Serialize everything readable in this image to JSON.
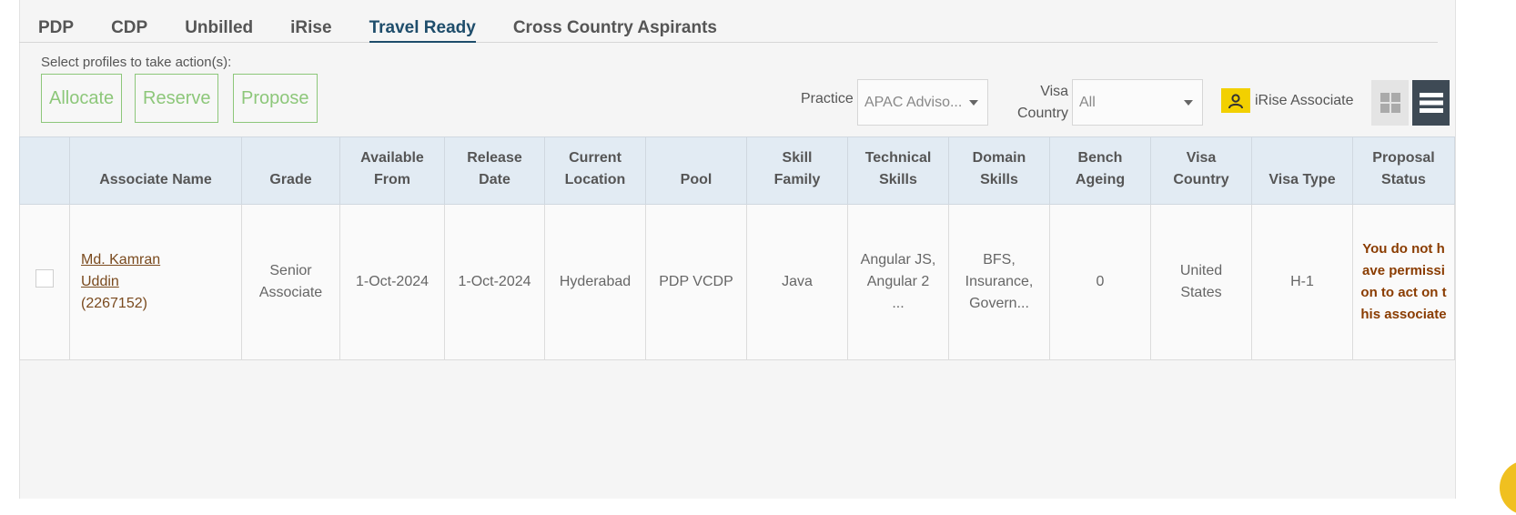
{
  "tabs": [
    {
      "label": "PDP",
      "active": false
    },
    {
      "label": "CDP",
      "active": false
    },
    {
      "label": "Unbilled",
      "active": false
    },
    {
      "label": "iRise",
      "active": false
    },
    {
      "label": "Travel Ready",
      "active": true
    },
    {
      "label": "Cross Country Aspirants",
      "active": false
    }
  ],
  "actions": {
    "prompt": "Select profiles to take action(s):",
    "allocate": "Allocate",
    "reserve": "Reserve",
    "propose": "Propose"
  },
  "filters": {
    "practice_label": "Practice",
    "practice_value": "APAC Adviso...",
    "visa_label_line1": "Visa",
    "visa_label_line2": "Country",
    "visa_value": "All"
  },
  "irise_toggle": {
    "label": "iRise Associate",
    "icon": "person-icon"
  },
  "view_toggle": {
    "grid_icon": "grid-view-icon",
    "list_icon": "list-view-icon"
  },
  "table": {
    "headers": [
      {
        "l1": "",
        "l2": ""
      },
      {
        "l1": "",
        "l2": "Associate Name"
      },
      {
        "l1": "",
        "l2": "Grade"
      },
      {
        "l1": "Available",
        "l2": "From"
      },
      {
        "l1": "Release",
        "l2": "Date"
      },
      {
        "l1": "Current",
        "l2": "Location"
      },
      {
        "l1": "",
        "l2": "Pool"
      },
      {
        "l1": "Skill",
        "l2": "Family"
      },
      {
        "l1": "Technical",
        "l2": "Skills"
      },
      {
        "l1": "Domain",
        "l2": "Skills"
      },
      {
        "l1": "Bench",
        "l2": "Ageing"
      },
      {
        "l1": "Visa",
        "l2": "Country"
      },
      {
        "l1": "",
        "l2": "Visa Type"
      },
      {
        "l1": "Proposal",
        "l2": "Status"
      }
    ],
    "rows": [
      {
        "name_line1": "Md. Kamran",
        "name_line2": "Uddin",
        "emp_id": "(2267152)",
        "grade_line1": "Senior",
        "grade_line2": "Associate",
        "available_from": "1-Oct-2024",
        "release_date": "1-Oct-2024",
        "location": "Hyderabad",
        "pool": "PDP VCDP",
        "skill_family": "Java",
        "tech_line1": "Angular JS,",
        "tech_line2": "Angular 2",
        "tech_line3": "...",
        "domain_line1": "BFS,",
        "domain_line2": "Insurance,",
        "domain_line3": "Govern...",
        "bench_ageing": "0",
        "visa_country_line1": "United",
        "visa_country_line2": "States",
        "visa_type": "H-1",
        "proposal_status": "You do not have permission to act on this associate"
      }
    ]
  }
}
